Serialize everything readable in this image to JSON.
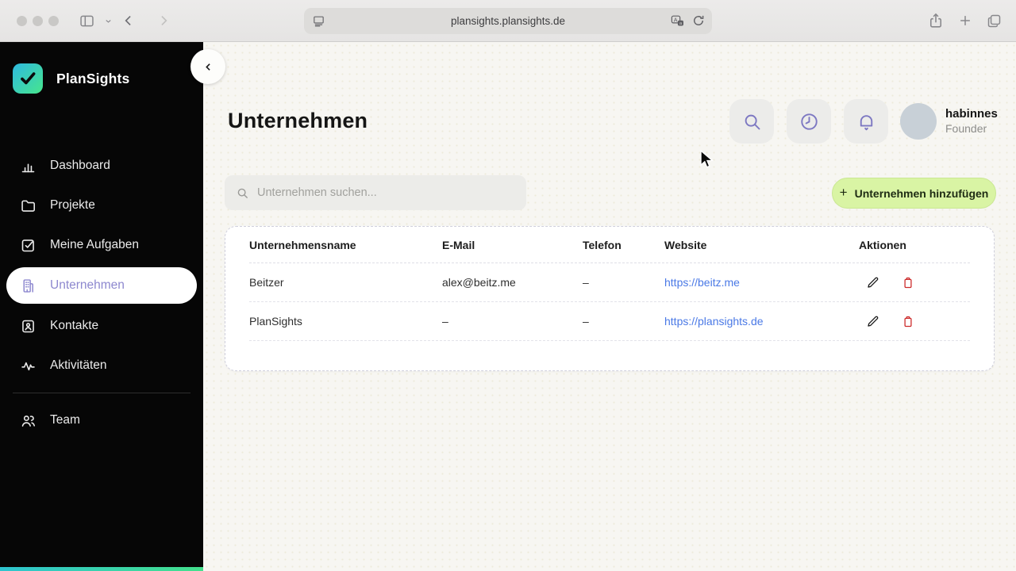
{
  "browser": {
    "url": "plansights.plansights.de",
    "icons": [
      "traffic-lights",
      "sidebar-toggle-icon",
      "back-icon",
      "forward-icon",
      "reader-view-icon",
      "translate-icon",
      "reload-icon",
      "share-icon",
      "new-tab-icon",
      "tabs-overview-icon"
    ]
  },
  "sidebar": {
    "brand": "PlanSights",
    "items": [
      {
        "label": "Dashboard",
        "icon": "bar-chart-icon",
        "active": false
      },
      {
        "label": "Projekte",
        "icon": "folder-icon",
        "active": false
      },
      {
        "label": "Meine Aufgaben",
        "icon": "check-square-icon",
        "active": false
      },
      {
        "label": "Unternehmen",
        "icon": "building-icon",
        "active": true
      },
      {
        "label": "Kontakte",
        "icon": "contact-card-icon",
        "active": false
      },
      {
        "label": "Aktivitäten",
        "icon": "activity-icon",
        "active": false
      }
    ],
    "footer_items": [
      {
        "label": "Team",
        "icon": "users-icon",
        "active": false
      }
    ]
  },
  "header": {
    "title": "Unternehmen",
    "action_icons": [
      "search-icon",
      "clock-icon",
      "bell-icon"
    ],
    "user": {
      "name": "habinnes",
      "role": "Founder"
    }
  },
  "toolbar": {
    "search_placeholder": "Unternehmen suchen...",
    "add_button_label": "Unternehmen hinzufügen",
    "add_button_plus": "+"
  },
  "table": {
    "columns": [
      "Unternehmensname",
      "E-Mail",
      "Telefon",
      "Website",
      "Aktionen"
    ],
    "rows": [
      {
        "name": "Beitzer",
        "email": "alex@beitz.me",
        "phone": "–",
        "website": "https://beitz.me"
      },
      {
        "name": "PlanSights",
        "email": "–",
        "phone": "–",
        "website": "https://plansights.de"
      }
    ],
    "row_action_icons": [
      "pencil-icon",
      "trash-icon"
    ]
  },
  "colors": {
    "sidebar_bg": "#060606",
    "accent_purple": "#8d88cf",
    "button_green": "#d9f4a4",
    "link_blue": "#4a79e6",
    "danger_red": "#cc2a2a",
    "logo_gradient_start": "#2eb9e0",
    "logo_gradient_end": "#47e68c"
  }
}
